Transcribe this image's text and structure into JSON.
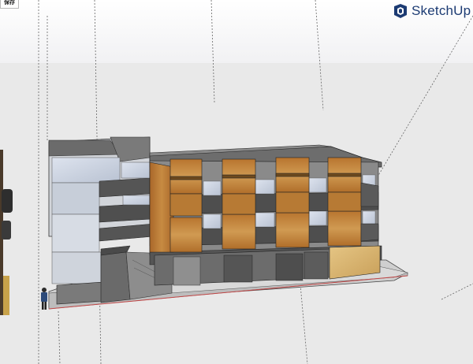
{
  "toolbar": {
    "save_label": "保存"
  },
  "brand": {
    "name": "SketchUp",
    "logo_icon": "sketchup-logo-icon"
  },
  "colors": {
    "sky": "#f4f4f6",
    "ground": "#ebebeb",
    "wood": "#c48a3e",
    "concrete_dark": "#5e5e5e",
    "concrete_light": "#a8a8a8",
    "glass": "#cfd6e2",
    "brand": "#1c3b73",
    "axis_red": "#c24848"
  }
}
